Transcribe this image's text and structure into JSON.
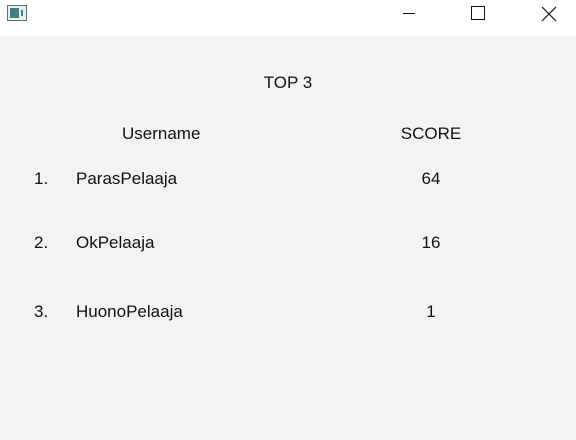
{
  "window": {
    "icon": "window-app-icon",
    "controls": [
      "minimize-icon",
      "maximize-icon",
      "close-icon"
    ]
  },
  "leaderboard": {
    "heading": "TOP 3",
    "columns": {
      "username": "Username",
      "score": "SCORE"
    },
    "rows": [
      {
        "rank": "1.",
        "username": "ParasPelaaja",
        "score": "64"
      },
      {
        "rank": "2.",
        "username": "OkPelaaja",
        "score": "16"
      },
      {
        "rank": "3.",
        "username": "HuonoPelaaja",
        "score": "1"
      }
    ]
  }
}
